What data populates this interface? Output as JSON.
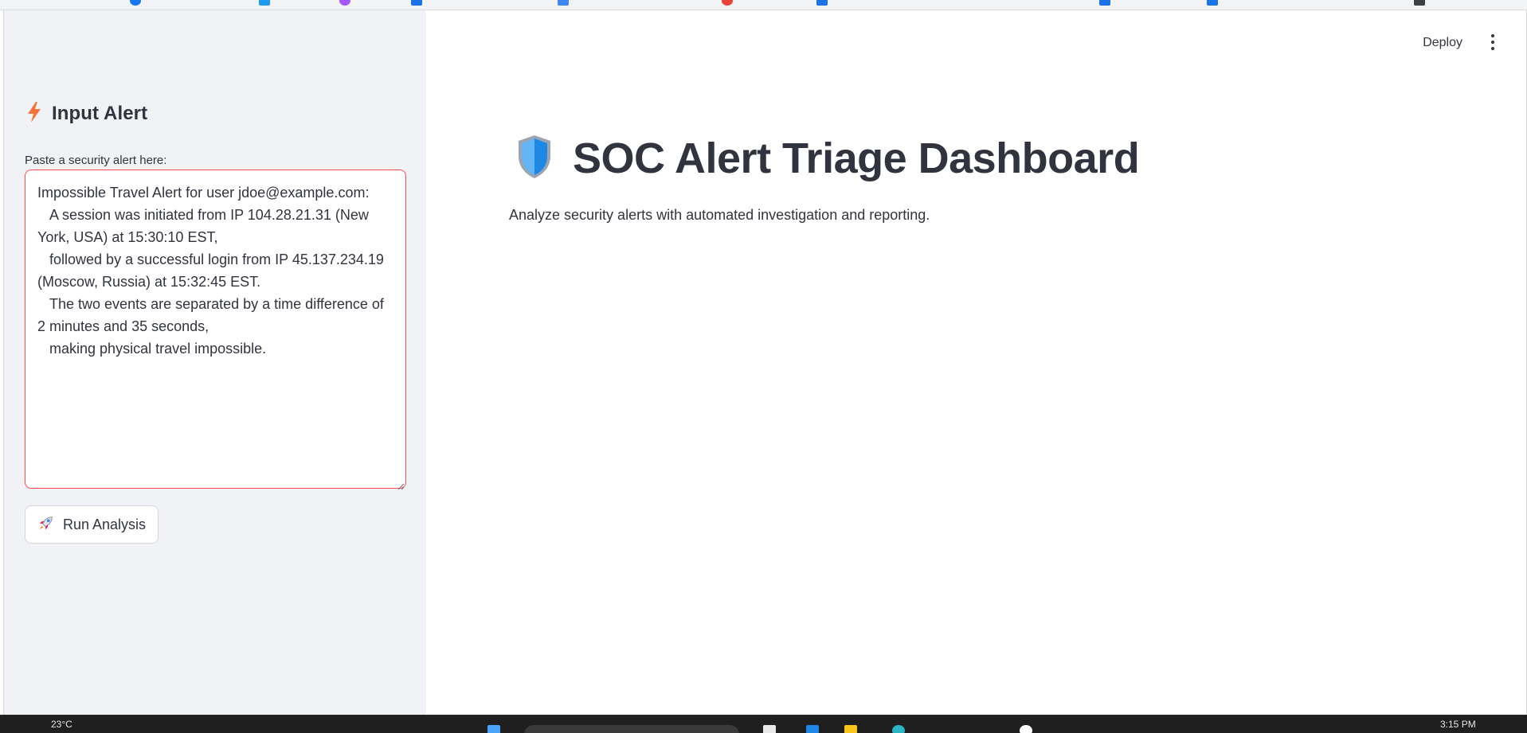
{
  "sidebar": {
    "header_icon": "lightning-icon",
    "header": "Input Alert",
    "field_label": "Paste a security alert here:",
    "alert_text": "Impossible Travel Alert for user jdoe@example.com:\n   A session was initiated from IP 104.28.21.31 (New York, USA) at 15:30:10 EST,\n   followed by a successful login from IP 45.137.234.19 (Moscow, Russia) at 15:32:45 EST.\n   The two events are separated by a time difference of 2 minutes and 35 seconds,\n   making physical travel impossible.",
    "run_button_icon": "rocket-icon",
    "run_button_label": "Run Analysis"
  },
  "toolbar": {
    "deploy_label": "Deploy",
    "menu_icon": "kebab-menu-icon"
  },
  "main": {
    "title_icon": "shield-icon",
    "title": "SOC Alert Triage Dashboard",
    "subtitle": "Analyze security alerts with automated investigation and reporting."
  },
  "taskbar": {
    "weather": "23°C",
    "clock": "3:15 PM"
  },
  "colors": {
    "accent": "#ff4b4b",
    "sidebar_bg": "#f0f2f6",
    "text": "#31333f"
  }
}
